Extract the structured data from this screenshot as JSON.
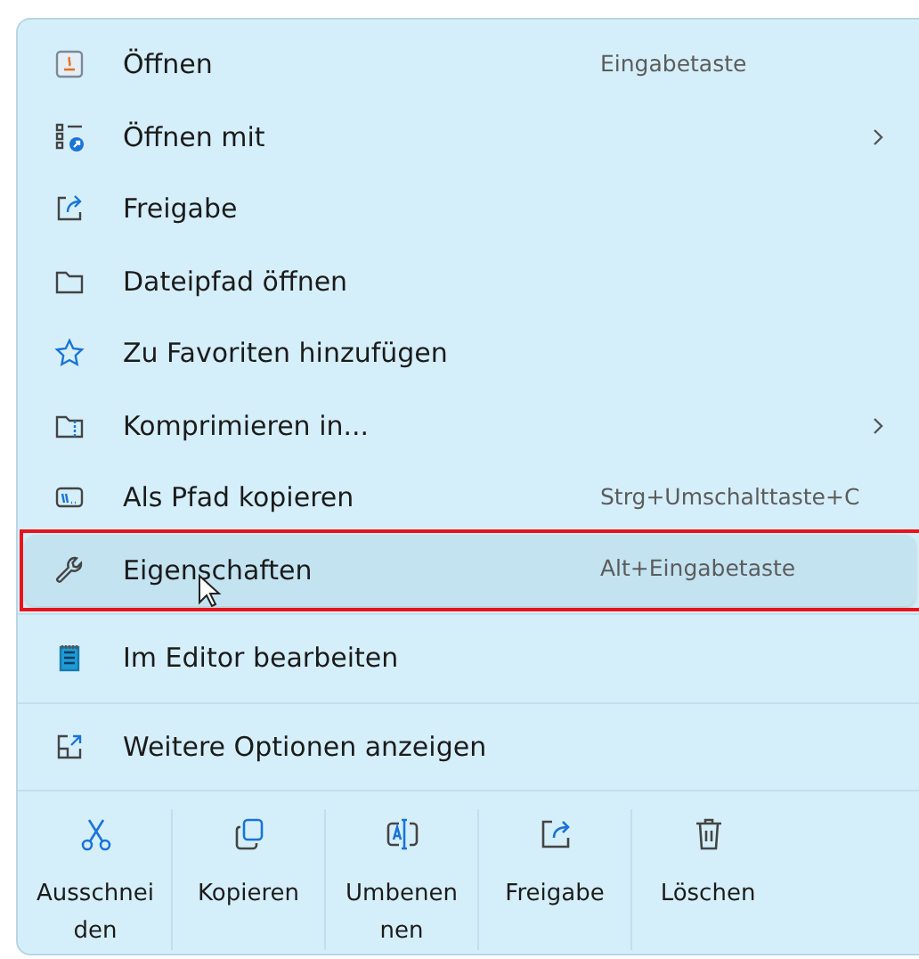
{
  "menu": {
    "groups": [
      {
        "items": [
          {
            "label": "Öffnen",
            "shortcut": "Eingabetaste",
            "submenu": false,
            "selected": false
          },
          {
            "label": "Öffnen mit",
            "submenu": true,
            "selected": false
          },
          {
            "label": "Freigabe",
            "submenu": false,
            "selected": false
          },
          {
            "label": "Dateipfad öffnen",
            "submenu": false,
            "selected": false
          },
          {
            "label": "Zu Favoriten hinzufügen",
            "submenu": false,
            "selected": false
          },
          {
            "label": "Komprimieren in...",
            "submenu": true,
            "selected": false
          },
          {
            "label": "Als Pfad kopieren",
            "shortcut": "Strg+Umschalttaste+C",
            "submenu": false,
            "selected": false
          },
          {
            "label": "Eigenschaften",
            "shortcut": "Alt+Eingabetaste",
            "submenu": false,
            "selected": true
          }
        ]
      },
      {
        "items": [
          {
            "label": "Im Editor bearbeiten",
            "submenu": false,
            "selected": false
          }
        ]
      },
      {
        "items": [
          {
            "label": "Weitere Optionen anzeigen",
            "submenu": false,
            "selected": false
          }
        ]
      }
    ],
    "toolbar": [
      {
        "label": "Ausschneiden"
      },
      {
        "label": "Kopieren"
      },
      {
        "label": "Umbenennen"
      },
      {
        "label": "Freigabe"
      },
      {
        "label": "Löschen"
      }
    ]
  }
}
